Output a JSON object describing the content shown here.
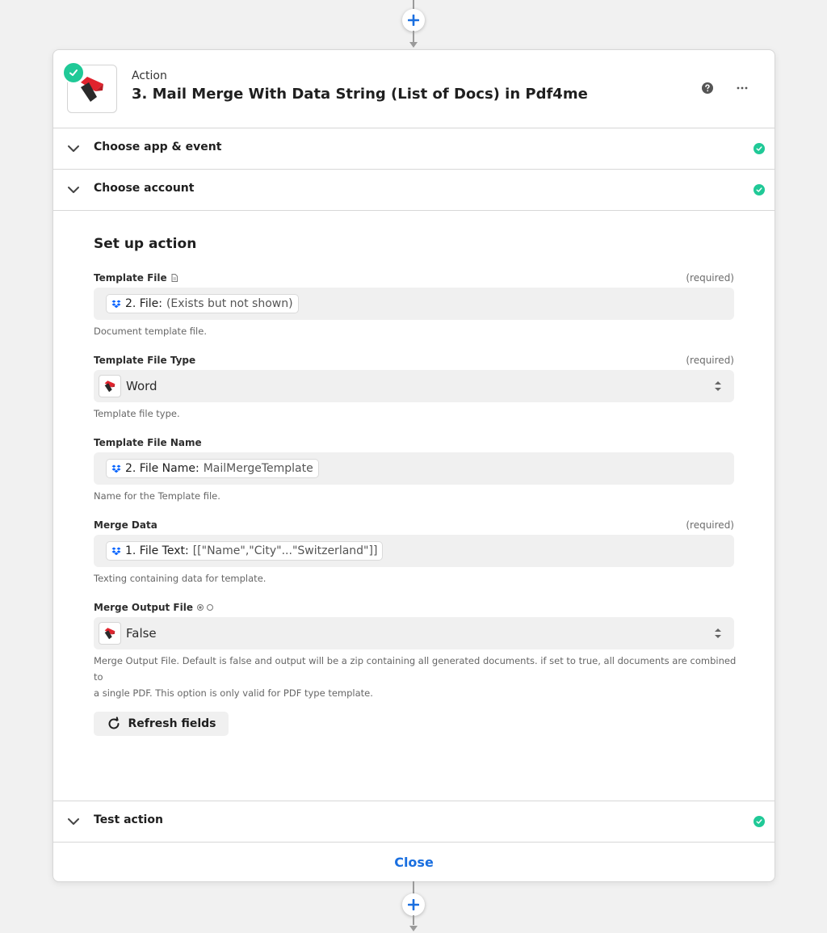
{
  "step": {
    "type_label": "Action",
    "title": "3. Mail Merge With Data String (List of Docs) in Pdf4me"
  },
  "sections": {
    "app_event": "Choose app & event",
    "account": "Choose account",
    "test": "Test action"
  },
  "setup": {
    "title": "Set up action",
    "required_label": "(required)",
    "fields": {
      "template_file": {
        "label": "Template File",
        "pill_strong": "2. File:",
        "pill_value": "(Exists but not shown)",
        "help": "Document template file."
      },
      "template_file_type": {
        "label": "Template File Type",
        "value": "Word",
        "help": "Template file type."
      },
      "template_file_name": {
        "label": "Template File Name",
        "pill_strong": "2. File Name:",
        "pill_value": "MailMergeTemplate",
        "help": "Name for the Template file."
      },
      "merge_data": {
        "label": "Merge Data",
        "pill_strong": "1. File Text:",
        "pill_value": "[[\"Name\",\"City\"...\"Switzerland\"]]",
        "help": "Texting containing data for template."
      },
      "merge_output_file": {
        "label": "Merge Output File",
        "value": "False",
        "help_line1": "Merge Output File. Default is false and output will be a zip containing all generated documents. if set to true, all documents are combined to",
        "help_line2": "a single PDF. This option is only valid for PDF type template."
      }
    },
    "refresh_label": "Refresh fields"
  },
  "footer": {
    "close_label": "Close"
  },
  "colors": {
    "accent_blue": "#1a6fe0",
    "success_green": "#20c997",
    "pdf4me_red": "#e0232d",
    "dropbox_blue": "#0061fe"
  }
}
